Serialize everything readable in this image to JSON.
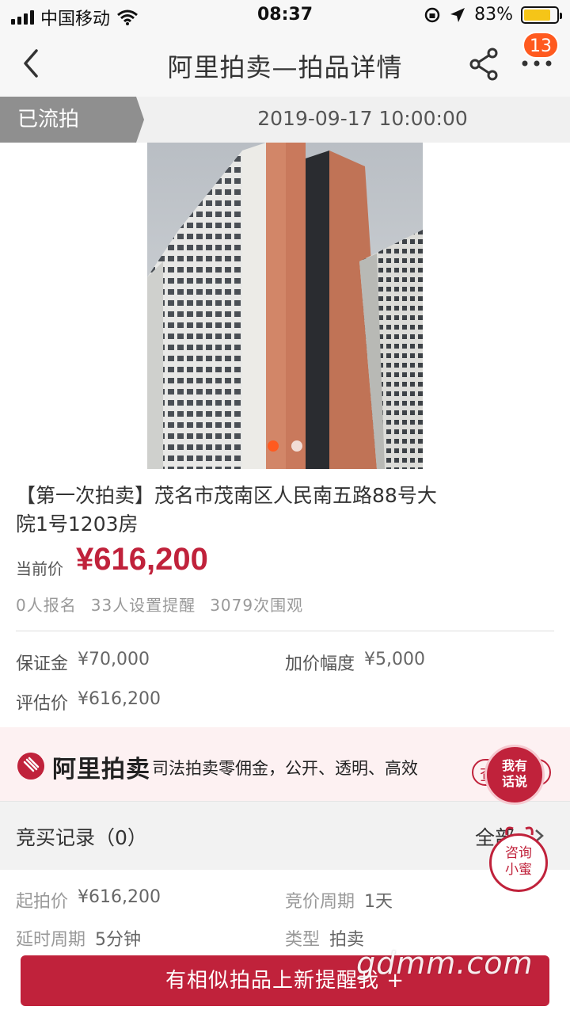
{
  "status_bar": {
    "carrier": "中国移动",
    "time": "08:37",
    "battery": "83%",
    "battery_level": 0.83
  },
  "nav": {
    "title": "阿里拍卖—拍品详情",
    "badge": "13"
  },
  "auction_status": {
    "tag": "已流拍",
    "datetime": "2019-09-17 10:00:00"
  },
  "gallery": {
    "image_count": 2,
    "active_index": 0
  },
  "item": {
    "title": "【第一次拍卖】茂名市茂南区人民南五路88号大院1号1203房",
    "price_label": "当前价",
    "price": "¥616,200",
    "stats": [
      "0人报名",
      "33人设置提醒",
      "3079次围观"
    ]
  },
  "details": {
    "deposit": {
      "label": "保证金",
      "value": "¥70,000"
    },
    "increment": {
      "label": "加价幅度",
      "value": "¥5,000"
    },
    "appraisal": {
      "label": "评估价",
      "value": "¥616,200"
    }
  },
  "promo": {
    "brand": "阿里拍卖",
    "slogan": "司法拍卖零佣金，公开、透明、高效",
    "button": "查"
  },
  "bid_record": {
    "title": "竞买记录（0）",
    "all": "全部"
  },
  "rules": {
    "start_price": {
      "label": "起拍价",
      "value": "¥616,200"
    },
    "bid_cycle": {
      "label": "竞价周期",
      "value": "1天"
    },
    "delay_cycle": {
      "label": "延时周期",
      "value": "5分钟"
    },
    "type": {
      "label": "类型",
      "value": "拍卖"
    }
  },
  "bubbles": {
    "talk": "我有话说",
    "consult": "咨询小蜜"
  },
  "bottom": {
    "remind_button": "有相似拍品上新提醒我 +",
    "watermark": "gdmm.com"
  },
  "colors": {
    "accent": "#c0223b",
    "badge": "#ff5a1f",
    "status_tag": "#8f8f8f"
  }
}
